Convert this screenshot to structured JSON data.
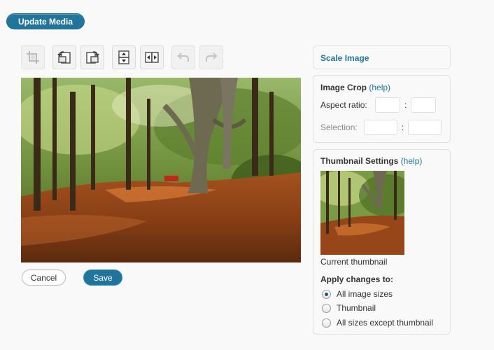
{
  "header": {
    "update_media_label": "Update Media"
  },
  "toolbar": {
    "tools": [
      {
        "name": "crop",
        "icon": "crop-icon",
        "enabled": false
      },
      {
        "name": "rotate-counter-clockwise",
        "icon": "rotate-left-icon",
        "enabled": true
      },
      {
        "name": "rotate-clockwise",
        "icon": "rotate-right-icon",
        "enabled": true
      },
      {
        "name": "flip-vertically",
        "icon": "flip-vertical-icon",
        "enabled": true
      },
      {
        "name": "flip-horizontally",
        "icon": "flip-horizontal-icon",
        "enabled": true
      },
      {
        "name": "undo",
        "icon": "undo-icon",
        "enabled": false
      },
      {
        "name": "redo",
        "icon": "redo-icon",
        "enabled": false
      }
    ]
  },
  "image": {
    "description": "forest path with autumn leaves"
  },
  "actions": {
    "cancel_label": "Cancel",
    "save_label": "Save"
  },
  "sidebar": {
    "scale": {
      "title": "Scale Image"
    },
    "crop": {
      "title": "Image Crop",
      "help": "(help)",
      "aspect_label": "Aspect ratio:",
      "aspect_sep": ":",
      "selection_label": "Selection:",
      "selection_sep": ":",
      "aspect_w": "",
      "aspect_h": "",
      "selection_w": "",
      "selection_h": ""
    },
    "thumbnail": {
      "title": "Thumbnail Settings",
      "help": "(help)",
      "caption": "Current thumbnail",
      "apply_title": "Apply changes to:",
      "options": [
        {
          "label": "All image sizes",
          "checked": true
        },
        {
          "label": "Thumbnail",
          "checked": false
        },
        {
          "label": "All sizes except thumbnail",
          "checked": false
        }
      ]
    }
  },
  "colors": {
    "accent": "#21759b",
    "link": "#21759b",
    "background": "#f9f9f9"
  }
}
